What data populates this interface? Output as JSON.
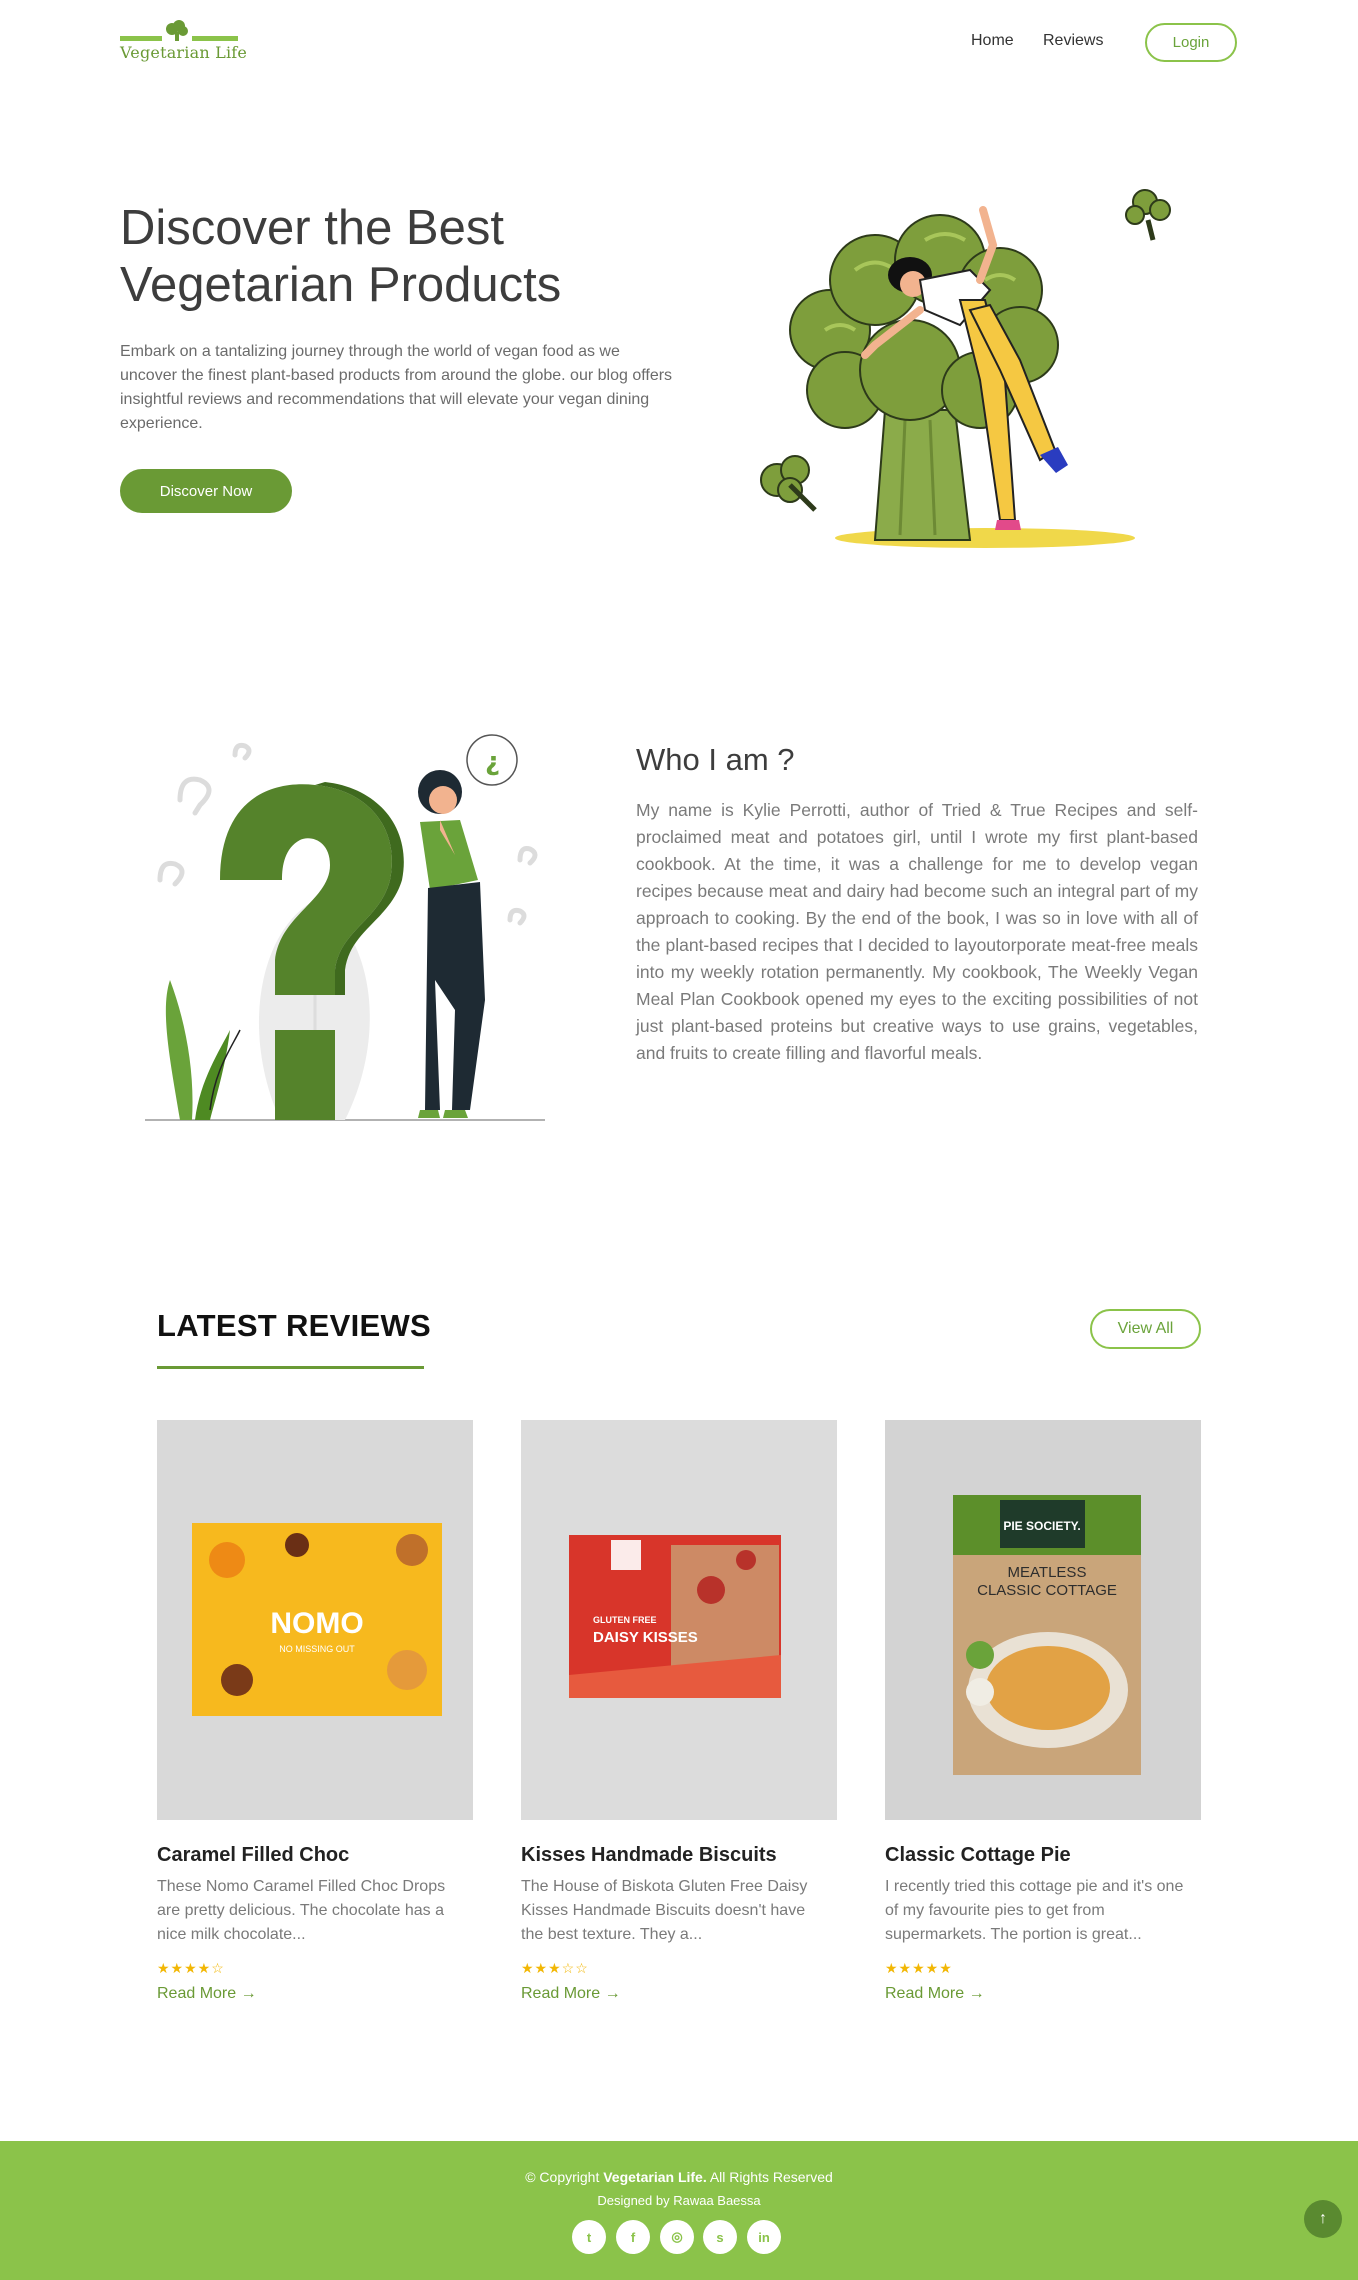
{
  "brand": {
    "name": "Vegetarian Life",
    "accent": "#8bc34a",
    "dark_accent": "#6a9a35"
  },
  "nav": {
    "home": "Home",
    "reviews": "Reviews",
    "login": "Login"
  },
  "hero": {
    "title": "Discover the Best Vegetarian Products",
    "text": "Embark on a tantalizing journey through the world of vegan food as we uncover the finest plant-based products from around the globe. our blog offers insightful reviews and recommendations that will elevate your vegan dining experience.",
    "button": "Discover Now"
  },
  "about": {
    "title": "Who I am ?",
    "text": "My name is Kylie Perrotti, author of Tried & True Recipes and self-proclaimed meat and potatoes girl, until I wrote my first plant-based cookbook. At the time, it was a challenge for me to develop vegan recipes because meat and dairy had become such an integral part of my approach to cooking. By the end of the book, I was so in love with all of the plant-based recipes that I decided to layoutorporate meat-free meals into my weekly rotation permanently. My cookbook, The Weekly Vegan Meal Plan Cookbook opened my eyes to the exciting possibilities of not just plant-based proteins but creative ways to use grains, vegetables, and fruits to create filling and flavorful meals."
  },
  "reviews": {
    "title": "LATEST REVIEWS",
    "view_all": "View All",
    "cards": [
      {
        "title": "Caramel Filled Choc",
        "text": "These Nomo Caramel Filled Choc Drops are pretty delicious. The chocolate has a nice milk chocolate...",
        "rating": 4,
        "stars": "★★★★☆",
        "read_more": "Read More →",
        "package_brand": "NOMO",
        "package_tagline": "NO MISSING OUT"
      },
      {
        "title": "Kisses Handmade Biscuits",
        "text": "The House of Biskota Gluten Free Daisy Kisses Handmade Biscuits doesn't have the best texture. They a...",
        "rating": 3,
        "stars": "★★★☆☆",
        "read_more": "Read More →",
        "package_line1": "GLUTEN FREE",
        "package_line2": "DAISY KISSES"
      },
      {
        "title": "Classic Cottage Pie",
        "text": "I recently tried this cottage pie and it's one of my favourite pies to get from supermarkets. The portion is great...",
        "rating": 5,
        "stars": "★★★★★",
        "read_more": "Read More →",
        "package_brand": "PIE SOCIETY.",
        "package_line1": "MEATLESS",
        "package_line2": "CLASSIC COTTAGE"
      }
    ]
  },
  "footer": {
    "copyright_prefix": "© Copyright ",
    "copyright_brand": "Vegetarian Life.",
    "copyright_suffix": " All Rights Reserved",
    "designed_by": "Designed by Rawaa Baessa",
    "social": [
      {
        "icon": "twitter-icon",
        "glyph": "t"
      },
      {
        "icon": "facebook-icon",
        "glyph": "f"
      },
      {
        "icon": "instagram-icon",
        "glyph": "◎"
      },
      {
        "icon": "skype-icon",
        "glyph": "s"
      },
      {
        "icon": "linkedin-icon",
        "glyph": "in"
      }
    ],
    "to_top_glyph": "↑"
  }
}
